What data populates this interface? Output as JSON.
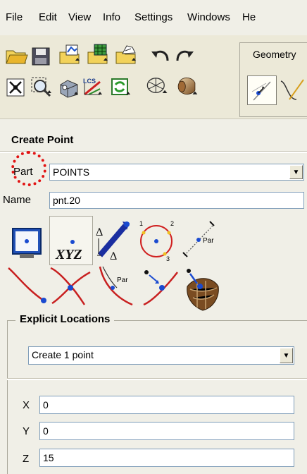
{
  "menu": {
    "items": [
      "File",
      "Edit",
      "View",
      "Info",
      "Settings",
      "Windows",
      "He"
    ]
  },
  "toolbar": {
    "icons": [
      "open-folder-icon",
      "save-icon",
      "import-geometry-icon",
      "import-mesh-icon",
      "export-icon",
      "undo-icon",
      "redo-icon",
      "fit-view-icon",
      "zoom-box-icon",
      "measure-icon",
      "lcs-icon",
      "refresh-mesh-icon",
      "solid-wire-icon",
      "shaded-solid-icon"
    ],
    "geometry_tab": "Geometry"
  },
  "panel": {
    "title": "Create Point",
    "part_label": "Part",
    "part_value": "POINTS",
    "name_label": "Name",
    "name_value": "pnt.20",
    "methods_row1": [
      "screen-select-icon",
      "xyz-icon",
      "base-delta-icon",
      "center-of-points-icon",
      "parameter-along-line-icon"
    ],
    "methods_row2": [
      "curve-ends-icon",
      "curve-curve-intersection-icon",
      "parameter-along-curve-icon",
      "projection-to-curve-icon",
      "projection-to-surface-icon"
    ],
    "xyz_text": "XYZ",
    "par_text": "Par",
    "explicit": {
      "title": "Explicit Locations",
      "mode_value": "Create 1 point",
      "x_label": "X",
      "x_value": "0",
      "y_label": "Y",
      "y_value": "0",
      "z_label": "Z",
      "z_value": "15"
    }
  },
  "colors": {
    "highlight": "#e21414",
    "window_bg": "#f0efe7",
    "input_border": "#7f9db9"
  }
}
